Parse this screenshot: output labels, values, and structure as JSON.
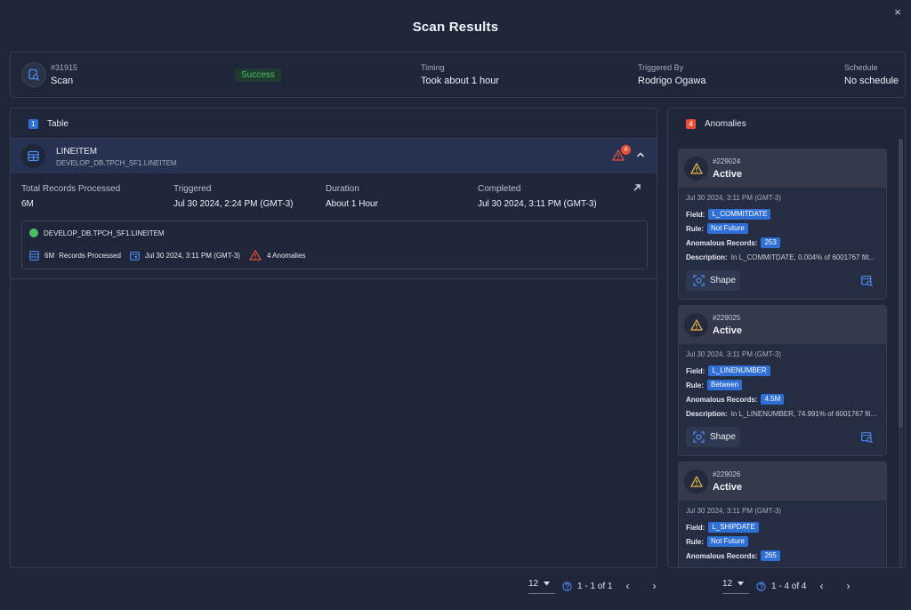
{
  "modal": {
    "title": "Scan Results",
    "close": "×"
  },
  "summary": {
    "id": "#31915",
    "type": "Scan",
    "status": "Success",
    "timing_label": "Timing",
    "timing_value": "Took about 1 hour",
    "triggered_label": "Triggered By",
    "triggered_value": "Rodrigo Ogawa",
    "schedule_label": "Schedule",
    "schedule_value": "No schedule"
  },
  "table_panel": {
    "count": "1",
    "title": "Table",
    "row": {
      "name": "LINEITEM",
      "path": "DEVELOP_DB.TPCH_SF1.LINEITEM",
      "anomaly_count": "4"
    },
    "metrics": [
      {
        "label": "Total Records Processed",
        "value": "6M"
      },
      {
        "label": "Triggered",
        "value": "Jul 30 2024, 2:24 PM (GMT-3)"
      },
      {
        "label": "Duration",
        "value": "About 1 Hour"
      },
      {
        "label": "Completed",
        "value": "Jul 30 2024, 3:11 PM (GMT-3)"
      }
    ],
    "detail": {
      "path": "DEVELOP_DB.TPCH_SF1.LINEITEM",
      "records_value": "6M",
      "records_label": "Records Processed",
      "date": "Jul 30 2024, 3:11 PM (GMT-3)",
      "anomalies": "4 Anomalies"
    },
    "pager": {
      "size": "12",
      "range": "1 - 1 of 1"
    }
  },
  "anomalies_panel": {
    "count": "4",
    "title": "Anomalies",
    "labels": {
      "field": "Field:",
      "rule": "Rule:",
      "records": "Anomalous Records:",
      "description": "Description:",
      "shape": "Shape"
    },
    "cards": [
      {
        "id": "#229024",
        "status": "Active",
        "date": "Jul 30 2024, 3:11 PM (GMT-3)",
        "field": "L_COMMITDATE",
        "rule": "Not Future",
        "records": "253",
        "description": "In L_COMMITDATE, 0.004% of 6001767 filt..."
      },
      {
        "id": "#229025",
        "status": "Active",
        "date": "Jul 30 2024, 3:11 PM (GMT-3)",
        "field": "L_LINENUMBER",
        "rule": "Between",
        "records": "4.5M",
        "description": "In L_LINENUMBER, 74.991% of 6001767 filt..."
      },
      {
        "id": "#229026",
        "status": "Active",
        "date": "Jul 30 2024, 3:11 PM (GMT-3)",
        "field": "L_SHIPDATE",
        "rule": "Not Future",
        "records": "265"
      }
    ],
    "pager": {
      "size": "12",
      "range": "1 - 4 of 4"
    }
  },
  "colors": {
    "accent": "#2f6fd6",
    "success": "#48c36d",
    "warning": "#e8503a",
    "alert_yellow": "#e8b84a"
  }
}
